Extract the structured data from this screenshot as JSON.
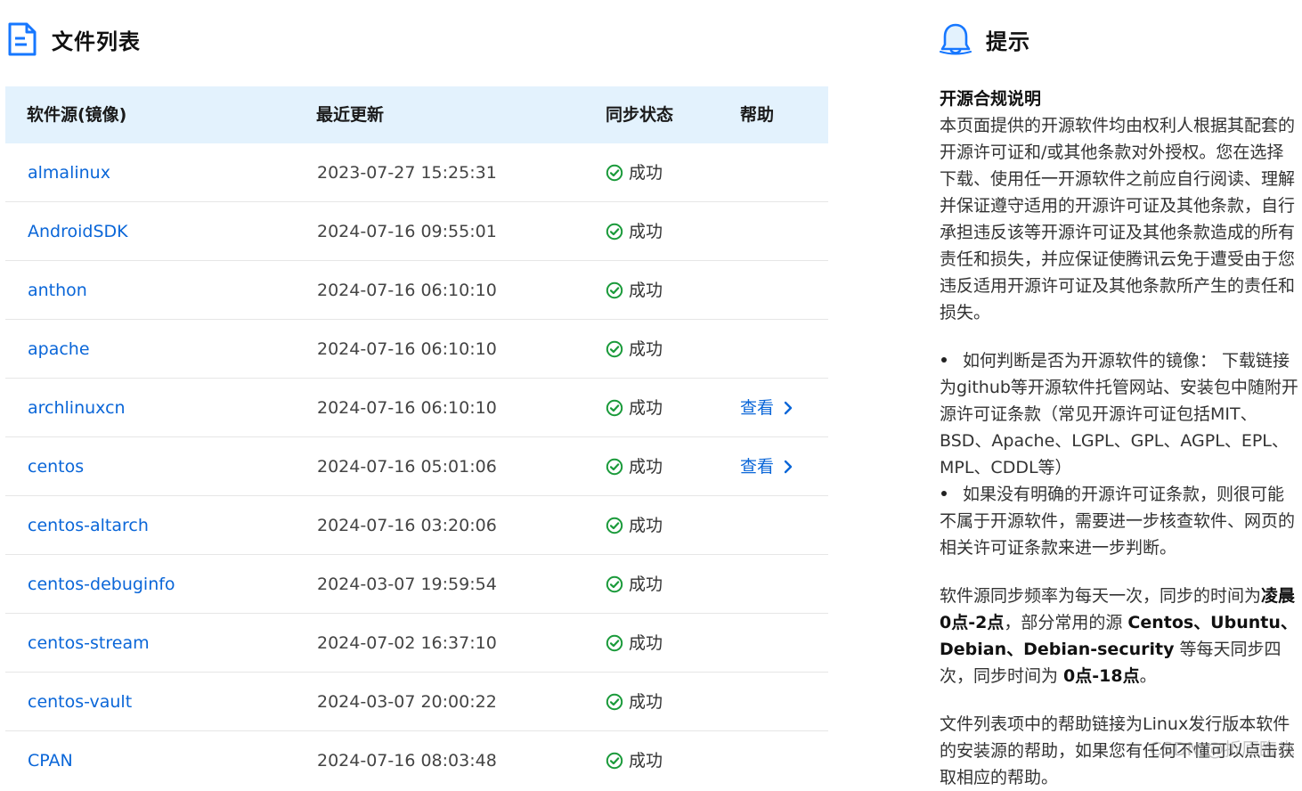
{
  "file_list": {
    "title": "文件列表",
    "columns": [
      "软件源(镜像)",
      "最近更新",
      "同步状态",
      "帮助"
    ],
    "rows": [
      {
        "name": "almalinux",
        "updated": "2023-07-27 15:25:31",
        "status": "成功",
        "help": ""
      },
      {
        "name": "AndroidSDK",
        "updated": "2024-07-16 09:55:01",
        "status": "成功",
        "help": ""
      },
      {
        "name": "anthon",
        "updated": "2024-07-16 06:10:10",
        "status": "成功",
        "help": ""
      },
      {
        "name": "apache",
        "updated": "2024-07-16 06:10:10",
        "status": "成功",
        "help": ""
      },
      {
        "name": "archlinuxcn",
        "updated": "2024-07-16 06:10:10",
        "status": "成功",
        "help": "查看"
      },
      {
        "name": "centos",
        "updated": "2024-07-16 05:01:06",
        "status": "成功",
        "help": "查看"
      },
      {
        "name": "centos-altarch",
        "updated": "2024-07-16 03:20:06",
        "status": "成功",
        "help": ""
      },
      {
        "name": "centos-debuginfo",
        "updated": "2024-03-07 19:59:54",
        "status": "成功",
        "help": ""
      },
      {
        "name": "centos-stream",
        "updated": "2024-07-02 16:37:10",
        "status": "成功",
        "help": ""
      },
      {
        "name": "centos-vault",
        "updated": "2024-03-07 20:00:22",
        "status": "成功",
        "help": ""
      },
      {
        "name": "CPAN",
        "updated": "2024-07-16 08:03:48",
        "status": "成功",
        "help": ""
      }
    ]
  },
  "tips": {
    "title": "提示",
    "heading": "开源合规说明",
    "paragraph1": "本页面提供的开源软件均由权利人根据其配套的开源许可证和/或其他条款对外授权。您在选择下载、使用任一开源软件之前应自行阅读、理解并保证遵守适用的开源许可证及其他条款，自行承担违反该等开源许可证及其他条款造成的所有责任和损失，并应保证使腾讯云免于遭受由于您违反适用开源许可证及其他条款所产生的责任和损失。",
    "bullets": [
      "如何判断是否为开源软件的镜像： 下载链接为github等开源软件托管网站、安装包中随附开源许可证条款（常见开源许可证包括MIT、BSD、Apache、LGPL、GPL、AGPL、EPL、MPL、CDDL等）",
      "如果没有明确的开源许可证条款，则很可能不属于开源软件，需要进一步核查软件、网页的相关许可证条款来进一步判断。"
    ],
    "sync": {
      "t1": "软件源同步频率为每天一次，同步的时间为",
      "b1": "凌晨0点-2点",
      "t2": "，部分常用的源 ",
      "b2": "Centos、Ubuntu、Debian、Debian-security",
      "t3": " 等每天同步四次，同步时间为 ",
      "b3": "0点-18点",
      "t4": "。"
    },
    "help_note": "文件列表项中的帮助链接为Linux发行版本软件的安装源的帮助，如果您有任何不懂可以点击获取相应的帮助。"
  },
  "watermark": "CSDN @折原臨也"
}
